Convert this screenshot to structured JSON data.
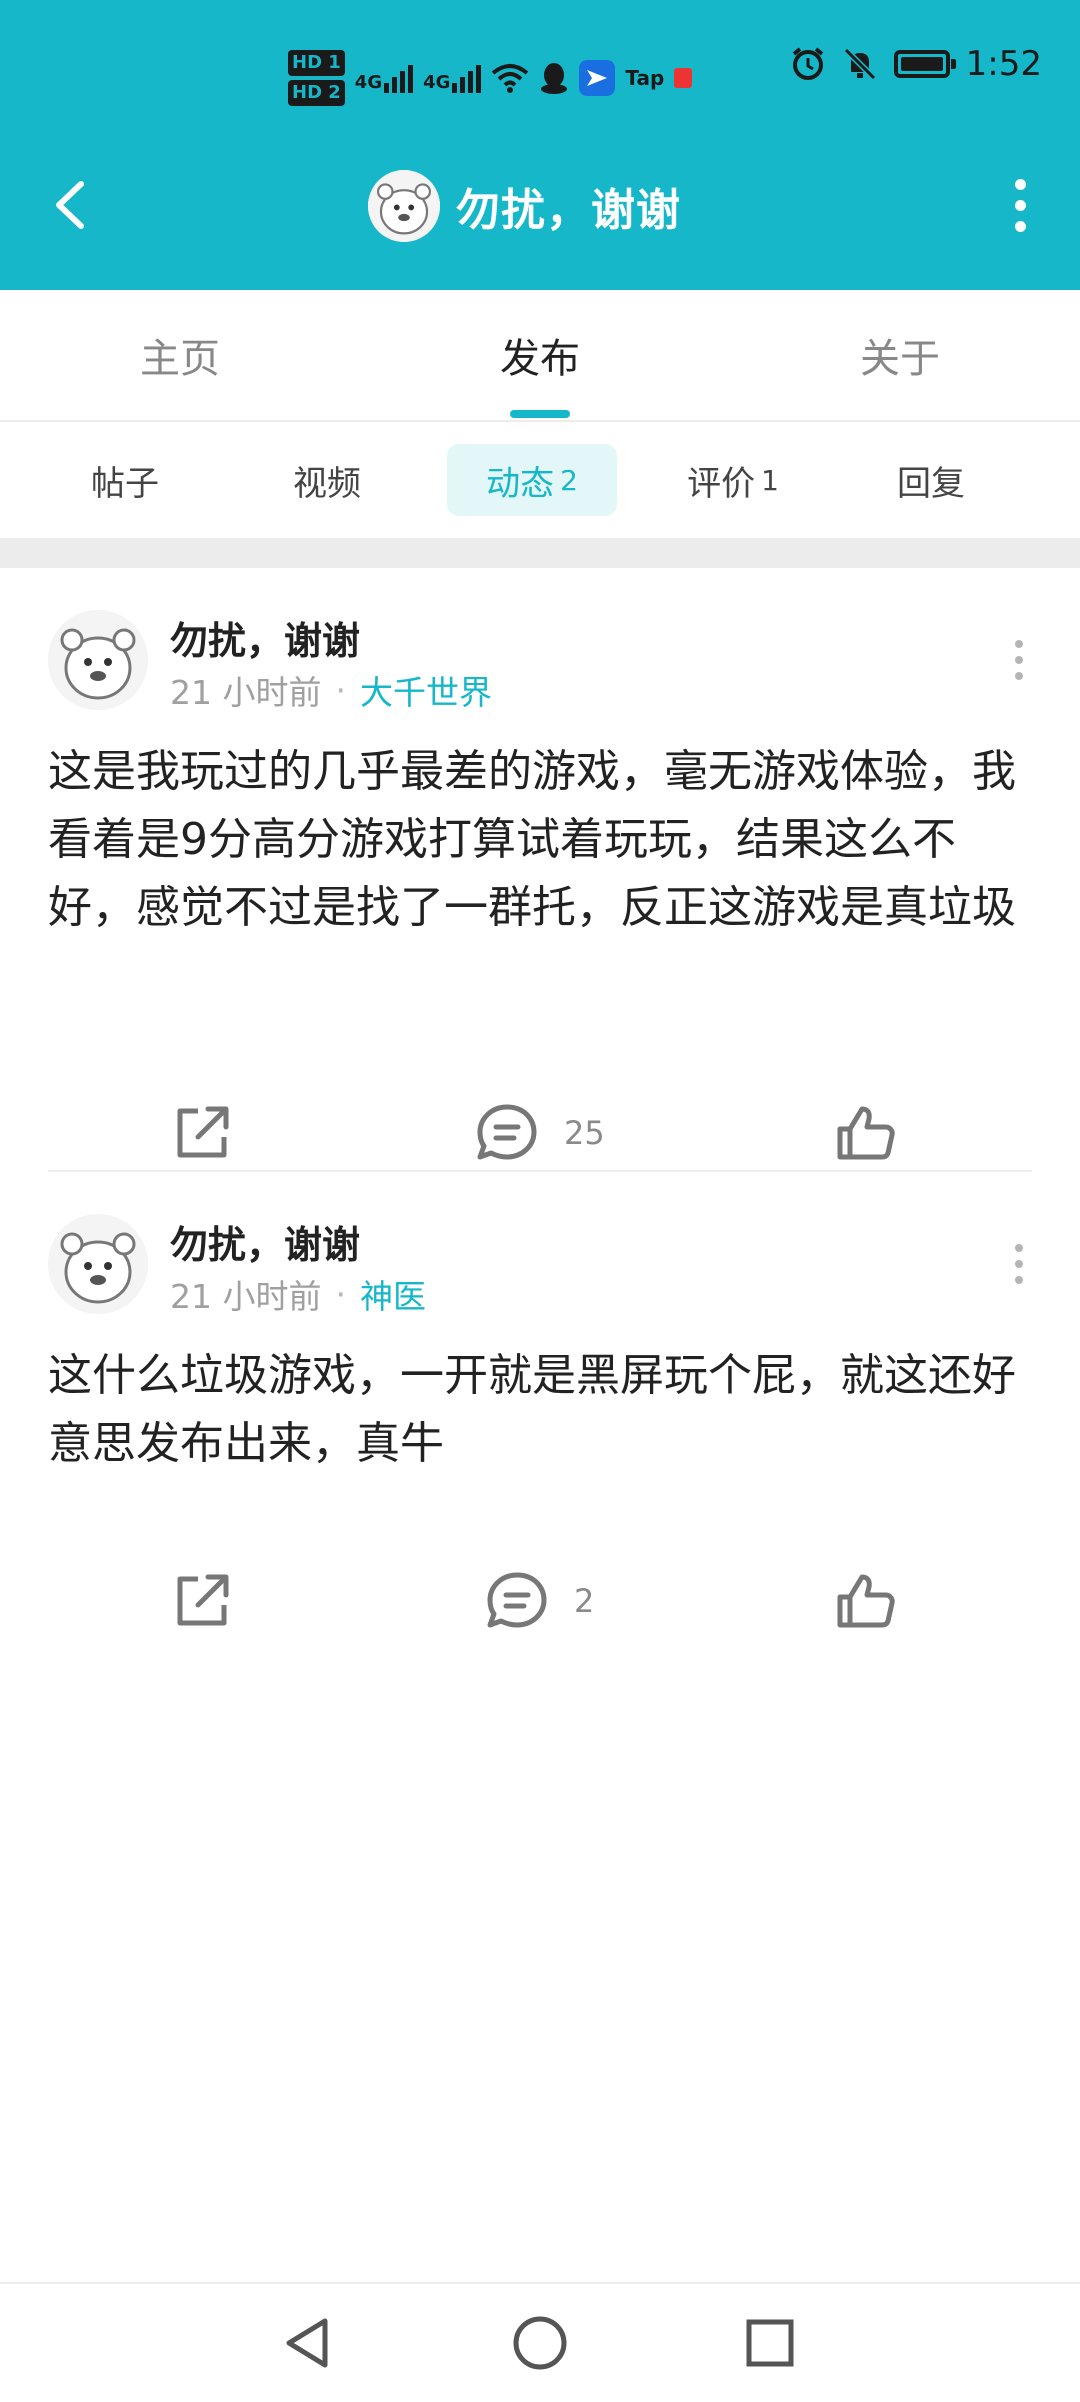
{
  "status_bar": {
    "time": "1:52",
    "hd1": "HD 1",
    "hd2": "HD 2",
    "net1": "4G",
    "net2": "4G",
    "app_badge": "Tap"
  },
  "header": {
    "title": "勿扰，谢谢",
    "background_color": "#16b7c8"
  },
  "main_tabs": [
    {
      "label": "主页"
    },
    {
      "label": "发布"
    },
    {
      "label": "关于"
    }
  ],
  "sub_tabs": [
    {
      "label": "帖子",
      "count": ""
    },
    {
      "label": "视频",
      "count": ""
    },
    {
      "label": "动态",
      "count": "2"
    },
    {
      "label": "评价",
      "count": "1"
    },
    {
      "label": "回复",
      "count": ""
    }
  ],
  "posts": [
    {
      "author": "勿扰，谢谢",
      "time": "21 小时前",
      "separator": "·",
      "topic": "大千世界",
      "content": "这是我玩过的几乎最差的游戏，毫无游戏体验，我看着是9分高分游戏打算试着玩玩，结果这么不好，感觉不过是找了一群托，反正这游戏是真垃圾",
      "comment_count": "25"
    },
    {
      "author": "勿扰，谢谢",
      "time": "21 小时前",
      "separator": "·",
      "topic": "神医",
      "content": "这什么垃圾游戏，一开就是黑屏玩个屁，就这还好意思发布出来，真牛",
      "comment_count": "2"
    }
  ],
  "icons": {
    "back": "chevron-left-icon",
    "more": "more-vertical-icon",
    "share": "share-icon",
    "comment": "comment-icon",
    "like": "thumbs-up-icon",
    "nav_back": "triangle-back-icon",
    "nav_home": "circle-home-icon",
    "nav_recent": "square-recent-icon"
  },
  "accent_color": "#16b7c8"
}
